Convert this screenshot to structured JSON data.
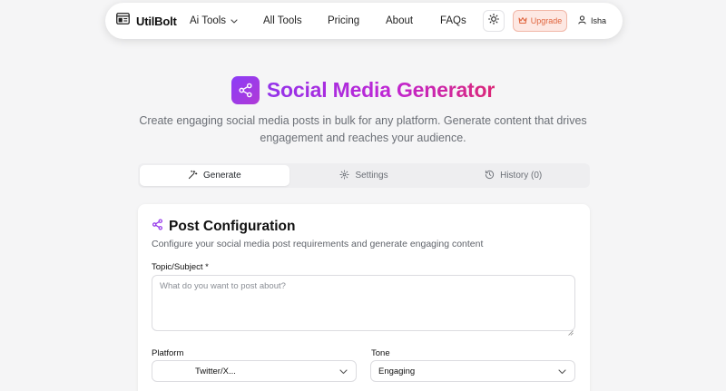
{
  "navbar": {
    "brand": "UtilBolt",
    "links": {
      "ai_tools": "Ai Tools",
      "all_tools": "All Tools",
      "pricing": "Pricing",
      "about": "About",
      "faqs": "FAQs"
    },
    "upgrade_label": "Upgrade",
    "user_name": "Isha",
    "icons": [
      "logo-icon",
      "chevron-down-icon",
      "sun-icon",
      "crown-icon",
      "user-icon"
    ]
  },
  "hero": {
    "title": "Social Media Generator",
    "subtitle": "Create engaging social media posts in bulk for any platform. Generate content that drives engagement and reaches your audience.",
    "icon": "share-icon"
  },
  "tabs": [
    {
      "label": "Generate",
      "icon": "magic-wand-icon",
      "active": true
    },
    {
      "label": "Settings",
      "icon": "gear-icon",
      "active": false
    },
    {
      "label": "History (0)",
      "icon": "history-icon",
      "active": false
    }
  ],
  "card": {
    "title": "Post Configuration",
    "description": "Configure your social media post requirements and generate engaging content",
    "topic": {
      "label": "Topic/Subject *",
      "placeholder": "What do you want to post about?",
      "value": ""
    },
    "platform": {
      "label": "Platform",
      "value": "Twitter/X..."
    },
    "tone": {
      "label": "Tone",
      "value": "Engaging"
    }
  },
  "colors": {
    "page_bg": "#f5f5f6",
    "accent_purple": "#9333ea",
    "accent_pink": "#db2777",
    "upgrade_text": "#e0663f",
    "upgrade_bg": "#fde8e3"
  }
}
